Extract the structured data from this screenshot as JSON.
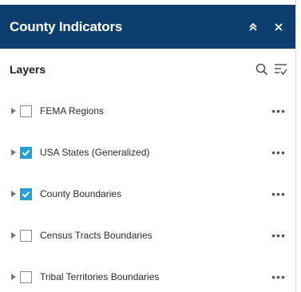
{
  "header": {
    "title": "County Indicators",
    "collapse_glyph": "»",
    "close_glyph": "×",
    "background": "#0d3e6e"
  },
  "toolbar": {
    "title": "Layers",
    "search_icon": "search-icon",
    "filter_icon": "filter-list-icon"
  },
  "layers": [
    {
      "label": "FEMA Regions",
      "checked": false
    },
    {
      "label": "USA States (Generalized)",
      "checked": true
    },
    {
      "label": "County Boundaries",
      "checked": true
    },
    {
      "label": "Census Tracts Boundaries",
      "checked": false
    },
    {
      "label": "Tribal Territories Boundaries",
      "checked": false
    }
  ],
  "colors": {
    "checkbox_checked": "#24a0d8",
    "text": "#2b2b2b"
  },
  "more_glyph": "•••"
}
